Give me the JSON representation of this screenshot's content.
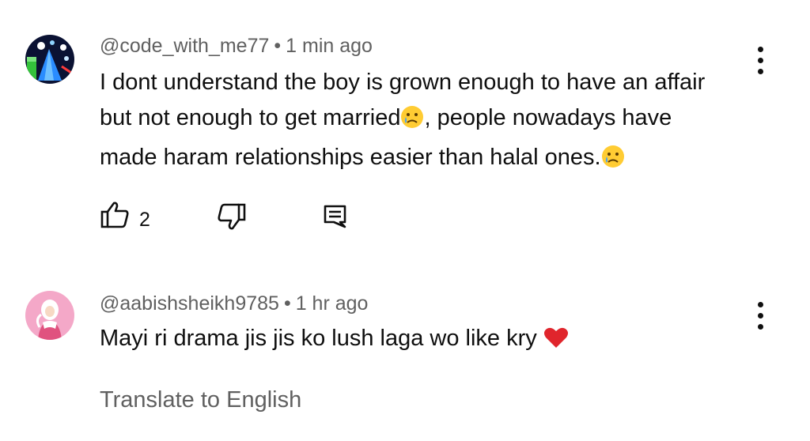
{
  "comments": [
    {
      "username": "@code_with_me77",
      "separator": "•",
      "time": "1 min ago",
      "text_parts": [
        "I dont understand the boy is grown enough to have an affair",
        "but not enough to get married",
        ", people nowadays have",
        "made haram relationships easier than halal ones."
      ],
      "emoji": "crying-face-emoji",
      "likes": "2",
      "icons": [
        "thumbs-up-icon",
        "thumbs-down-icon",
        "reply-icon",
        "more-vert-icon"
      ]
    },
    {
      "username": "@aabishsheikh9785",
      "separator": "•",
      "time": "1 hr ago",
      "text": "Mayi ri drama jis jis ko lush laga wo like kry",
      "emoji": "red-heart-emoji",
      "translate_label": "Translate to English"
    }
  ]
}
